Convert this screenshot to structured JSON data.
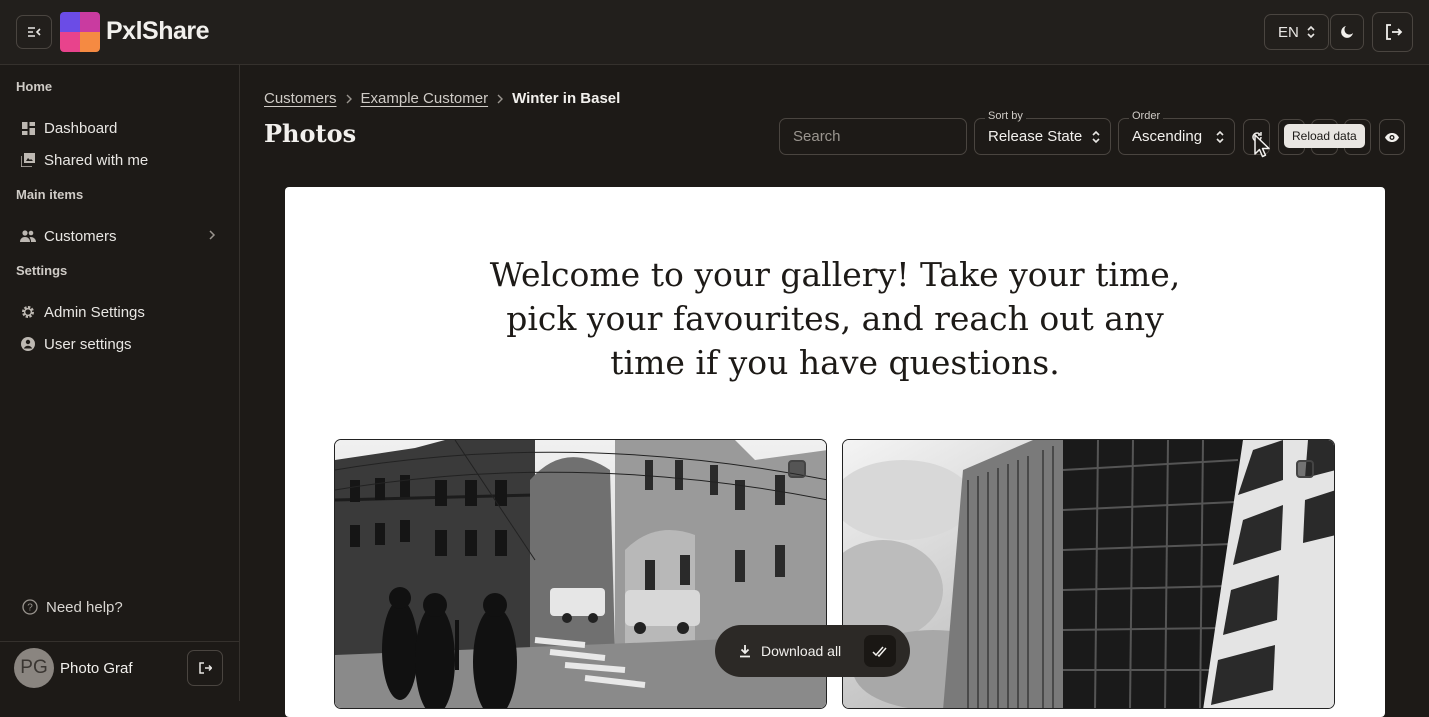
{
  "app": {
    "brand": "PxlShare"
  },
  "topbar": {
    "language": "EN"
  },
  "sidebar": {
    "sections": [
      {
        "label": "Home"
      },
      {
        "label": "Main items"
      },
      {
        "label": "Settings"
      }
    ],
    "items": [
      {
        "label": "Dashboard",
        "icon": "dashboard-icon"
      },
      {
        "label": "Shared with me",
        "icon": "photo-library-icon"
      },
      {
        "label": "Customers",
        "icon": "people-icon"
      },
      {
        "label": "Admin Settings",
        "icon": "gear-icon"
      },
      {
        "label": "User settings",
        "icon": "user-circle-icon"
      }
    ],
    "help": "Need help?",
    "user": {
      "initials": "PG",
      "name": "Photo Graf"
    }
  },
  "breadcrumb": {
    "items": [
      "Customers",
      "Example Customer"
    ],
    "current": "Winter in Basel"
  },
  "page": {
    "title": "Photos"
  },
  "toolbar": {
    "search_placeholder": "Search",
    "sort_label": "Sort by",
    "sort_value": "Release State",
    "order_label": "Order",
    "order_value": "Ascending",
    "tooltip": "Reload data"
  },
  "gallery": {
    "welcome": "Welcome to your gallery! Take your time, pick your favourites, and reach out any time if you have questions.",
    "download_all": "Download all"
  }
}
